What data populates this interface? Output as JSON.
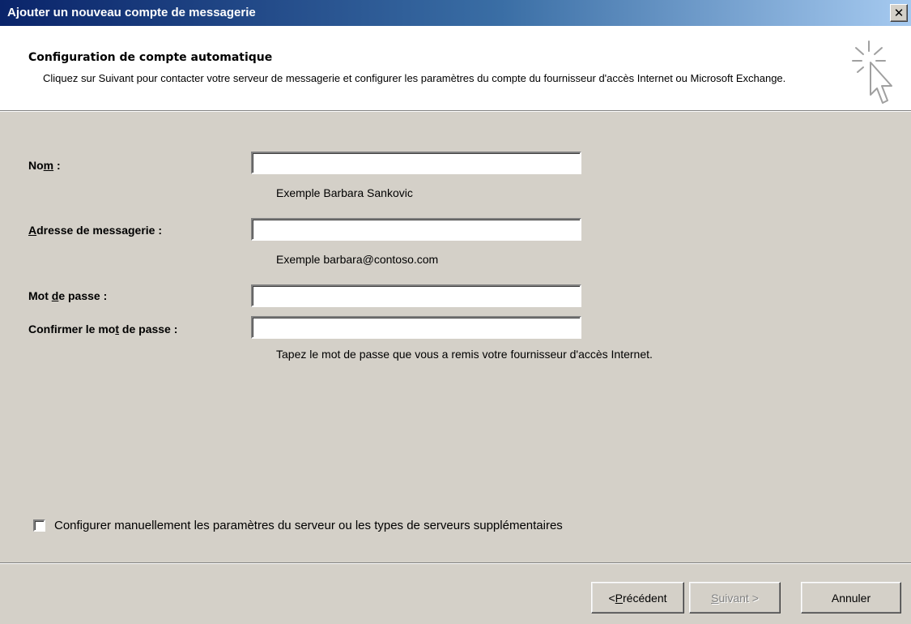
{
  "window": {
    "title": "Ajouter un nouveau compte de messagerie",
    "close_glyph": "✕"
  },
  "header": {
    "title": "Configuration de compte automatique",
    "description": "Cliquez sur Suivant pour contacter votre serveur de messagerie et configurer les paramètres du compte du fournisseur d'accès Internet ou Microsoft Exchange.",
    "icon": "wizard-cursor-icon"
  },
  "form": {
    "name": {
      "label_pre": "No",
      "label_access": "m",
      "label_post": " :",
      "value": "",
      "hint": "Exemple   Barbara Sankovic"
    },
    "email": {
      "label_pre": "",
      "label_access": "A",
      "label_post": "dresse de messagerie :",
      "value": "",
      "hint": "Exemple   barbara@contoso.com"
    },
    "password": {
      "label_pre": "Mot ",
      "label_access": "d",
      "label_post": "e passe :",
      "value": ""
    },
    "confirm_password": {
      "label_pre": "Confirmer le mo",
      "label_access": "t",
      "label_post": " de passe :",
      "value": "",
      "hint": "Tapez le mot de passe que vous a remis votre fournisseur d'accès Internet."
    }
  },
  "manual_config": {
    "label": "Configurer manuellement les paramètres du serveur ou les types de serveurs supplémentaires",
    "checked": false
  },
  "buttons": {
    "previous_access": "P",
    "previous_pre": "< ",
    "previous_post": "récédent",
    "next_access": "S",
    "next_post": "uivant >",
    "next_disabled": true,
    "cancel": "Annuler"
  },
  "colors": {
    "title_bar_start": "#0a246a",
    "title_bar_end": "#a6caf0",
    "dialog_background": "#d4d0c8",
    "header_background": "#ffffff"
  }
}
